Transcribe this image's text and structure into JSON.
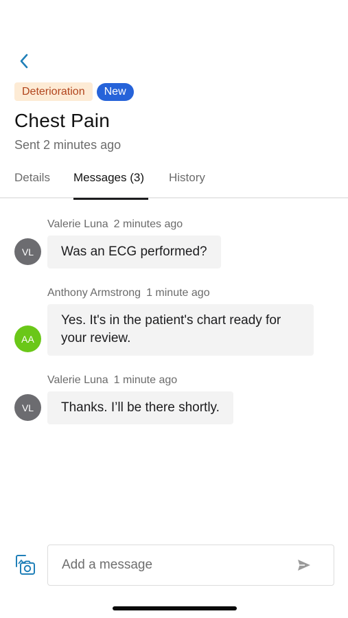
{
  "header": {
    "tag_label": "Deterioration",
    "new_badge": "New",
    "title": "Chest Pain",
    "subtitle": "Sent 2 minutes ago"
  },
  "tabs": [
    {
      "label": "Details",
      "active": false
    },
    {
      "label": "Messages (3)",
      "active": true
    },
    {
      "label": "History",
      "active": false
    }
  ],
  "messages": [
    {
      "author": "Valerie Luna",
      "time": "2 minutes ago",
      "initials": "VL",
      "avatar_color": "#6c6c70",
      "lines": [
        "Was an ECG performed?"
      ]
    },
    {
      "author": "Anthony Armstrong",
      "time": "1 minute ago",
      "initials": "AA",
      "avatar_color": "#6ac718",
      "lines": [
        "Yes. It's in the patient's chart ready for",
        "your review."
      ]
    },
    {
      "author": "Valerie Luna",
      "time": "1 minute ago",
      "initials": "VL",
      "avatar_color": "#6c6c70",
      "lines": [
        "Thanks. I’ll be there shortly."
      ]
    }
  ],
  "composer": {
    "placeholder": "Add a message",
    "value": ""
  },
  "icons": {
    "back": "chevron-left-icon",
    "attach": "camera-icon",
    "send": "send-icon"
  },
  "colors": {
    "accent": "#2663d9",
    "tag_bg": "#fdebd5",
    "tag_text": "#b1441c",
    "back_chevron": "#1f7fb8",
    "attach_icon": "#1f7fb8"
  }
}
